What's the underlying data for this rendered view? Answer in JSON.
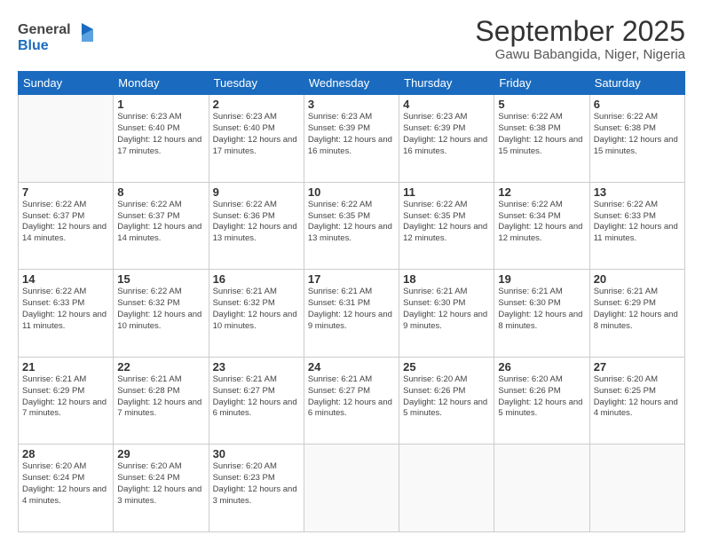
{
  "header": {
    "logo_general": "General",
    "logo_blue": "Blue",
    "month_title": "September 2025",
    "subtitle": "Gawu Babangida, Niger, Nigeria"
  },
  "calendar": {
    "headers": [
      "Sunday",
      "Monday",
      "Tuesday",
      "Wednesday",
      "Thursday",
      "Friday",
      "Saturday"
    ],
    "weeks": [
      [
        {
          "day": "",
          "info": ""
        },
        {
          "day": "1",
          "info": "Sunrise: 6:23 AM\nSunset: 6:40 PM\nDaylight: 12 hours\nand 17 minutes."
        },
        {
          "day": "2",
          "info": "Sunrise: 6:23 AM\nSunset: 6:40 PM\nDaylight: 12 hours\nand 17 minutes."
        },
        {
          "day": "3",
          "info": "Sunrise: 6:23 AM\nSunset: 6:39 PM\nDaylight: 12 hours\nand 16 minutes."
        },
        {
          "day": "4",
          "info": "Sunrise: 6:23 AM\nSunset: 6:39 PM\nDaylight: 12 hours\nand 16 minutes."
        },
        {
          "day": "5",
          "info": "Sunrise: 6:22 AM\nSunset: 6:38 PM\nDaylight: 12 hours\nand 15 minutes."
        },
        {
          "day": "6",
          "info": "Sunrise: 6:22 AM\nSunset: 6:38 PM\nDaylight: 12 hours\nand 15 minutes."
        }
      ],
      [
        {
          "day": "7",
          "info": "Sunrise: 6:22 AM\nSunset: 6:37 PM\nDaylight: 12 hours\nand 14 minutes."
        },
        {
          "day": "8",
          "info": "Sunrise: 6:22 AM\nSunset: 6:37 PM\nDaylight: 12 hours\nand 14 minutes."
        },
        {
          "day": "9",
          "info": "Sunrise: 6:22 AM\nSunset: 6:36 PM\nDaylight: 12 hours\nand 13 minutes."
        },
        {
          "day": "10",
          "info": "Sunrise: 6:22 AM\nSunset: 6:35 PM\nDaylight: 12 hours\nand 13 minutes."
        },
        {
          "day": "11",
          "info": "Sunrise: 6:22 AM\nSunset: 6:35 PM\nDaylight: 12 hours\nand 12 minutes."
        },
        {
          "day": "12",
          "info": "Sunrise: 6:22 AM\nSunset: 6:34 PM\nDaylight: 12 hours\nand 12 minutes."
        },
        {
          "day": "13",
          "info": "Sunrise: 6:22 AM\nSunset: 6:33 PM\nDaylight: 12 hours\nand 11 minutes."
        }
      ],
      [
        {
          "day": "14",
          "info": "Sunrise: 6:22 AM\nSunset: 6:33 PM\nDaylight: 12 hours\nand 11 minutes."
        },
        {
          "day": "15",
          "info": "Sunrise: 6:22 AM\nSunset: 6:32 PM\nDaylight: 12 hours\nand 10 minutes."
        },
        {
          "day": "16",
          "info": "Sunrise: 6:21 AM\nSunset: 6:32 PM\nDaylight: 12 hours\nand 10 minutes."
        },
        {
          "day": "17",
          "info": "Sunrise: 6:21 AM\nSunset: 6:31 PM\nDaylight: 12 hours\nand 9 minutes."
        },
        {
          "day": "18",
          "info": "Sunrise: 6:21 AM\nSunset: 6:30 PM\nDaylight: 12 hours\nand 9 minutes."
        },
        {
          "day": "19",
          "info": "Sunrise: 6:21 AM\nSunset: 6:30 PM\nDaylight: 12 hours\nand 8 minutes."
        },
        {
          "day": "20",
          "info": "Sunrise: 6:21 AM\nSunset: 6:29 PM\nDaylight: 12 hours\nand 8 minutes."
        }
      ],
      [
        {
          "day": "21",
          "info": "Sunrise: 6:21 AM\nSunset: 6:29 PM\nDaylight: 12 hours\nand 7 minutes."
        },
        {
          "day": "22",
          "info": "Sunrise: 6:21 AM\nSunset: 6:28 PM\nDaylight: 12 hours\nand 7 minutes."
        },
        {
          "day": "23",
          "info": "Sunrise: 6:21 AM\nSunset: 6:27 PM\nDaylight: 12 hours\nand 6 minutes."
        },
        {
          "day": "24",
          "info": "Sunrise: 6:21 AM\nSunset: 6:27 PM\nDaylight: 12 hours\nand 6 minutes."
        },
        {
          "day": "25",
          "info": "Sunrise: 6:20 AM\nSunset: 6:26 PM\nDaylight: 12 hours\nand 5 minutes."
        },
        {
          "day": "26",
          "info": "Sunrise: 6:20 AM\nSunset: 6:26 PM\nDaylight: 12 hours\nand 5 minutes."
        },
        {
          "day": "27",
          "info": "Sunrise: 6:20 AM\nSunset: 6:25 PM\nDaylight: 12 hours\nand 4 minutes."
        }
      ],
      [
        {
          "day": "28",
          "info": "Sunrise: 6:20 AM\nSunset: 6:24 PM\nDaylight: 12 hours\nand 4 minutes."
        },
        {
          "day": "29",
          "info": "Sunrise: 6:20 AM\nSunset: 6:24 PM\nDaylight: 12 hours\nand 3 minutes."
        },
        {
          "day": "30",
          "info": "Sunrise: 6:20 AM\nSunset: 6:23 PM\nDaylight: 12 hours\nand 3 minutes."
        },
        {
          "day": "",
          "info": ""
        },
        {
          "day": "",
          "info": ""
        },
        {
          "day": "",
          "info": ""
        },
        {
          "day": "",
          "info": ""
        }
      ]
    ]
  }
}
